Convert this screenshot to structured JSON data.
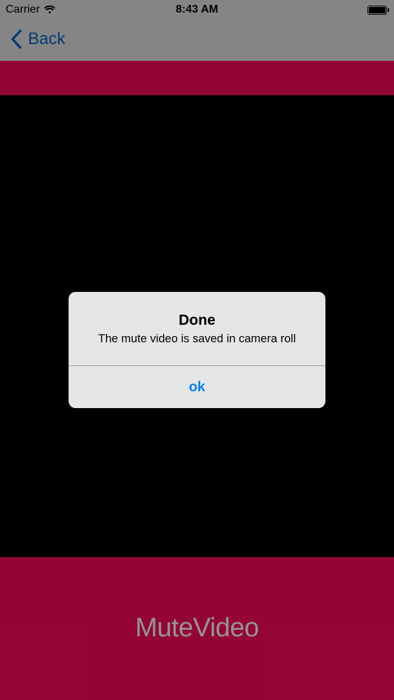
{
  "status_bar": {
    "carrier": "Carrier",
    "time": "8:43 AM"
  },
  "nav": {
    "back_label": "Back"
  },
  "app": {
    "title": "MuteVideo"
  },
  "alert": {
    "title": "Done",
    "message": "The mute video is saved in camera roll",
    "ok_label": "ok"
  },
  "colors": {
    "brand": "#ff0a5a",
    "link_blue": "#0a7ff0",
    "nav_back_blue": "#0a64c8"
  },
  "icons": [
    "wifi-icon",
    "battery-icon",
    "back-chevron-icon"
  ]
}
